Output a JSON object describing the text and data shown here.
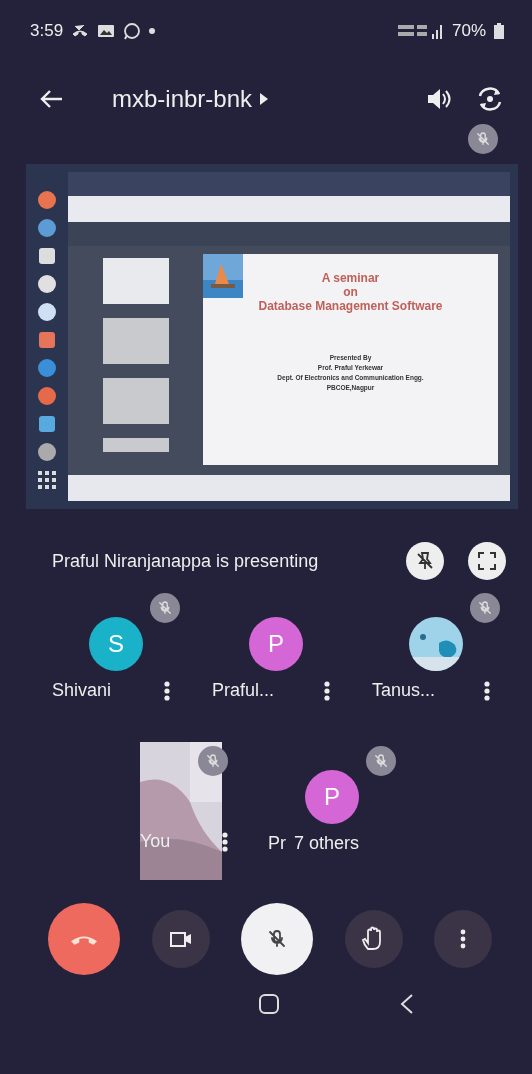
{
  "status_bar": {
    "time": "3:59",
    "battery": "70%"
  },
  "header": {
    "title": "mxb-inbr-bnk"
  },
  "presentation": {
    "slide_title": [
      "A seminar",
      "on",
      "Database Management Software"
    ],
    "slide_credits": [
      "Presented By",
      "Prof. Praful Yerkewar",
      "Dept. Of Electronics and Communication Engg.",
      "PBCOE,Nagpur"
    ],
    "presenter": "Praful Niranjanappa is presenting"
  },
  "participants": [
    {
      "name": "Shivani",
      "kind": "letter",
      "avatar": "S",
      "color": "#1ab2c9",
      "muted": true
    },
    {
      "name": "Praful...",
      "kind": "letter",
      "avatar": "P",
      "color": "#d466d6",
      "muted": false
    },
    {
      "name": "Tanus...",
      "kind": "picture",
      "muted": true
    },
    {
      "name": "You",
      "kind": "video",
      "muted": true
    },
    {
      "name": "7 others",
      "prefix": "Pr",
      "kind": "letter",
      "avatar": "P",
      "color": "#d466d6",
      "muted": true
    }
  ],
  "controls": [
    {
      "kind": "hangup"
    },
    {
      "kind": "camera"
    },
    {
      "kind": "mic",
      "muted": true
    },
    {
      "kind": "hand"
    },
    {
      "kind": "more"
    }
  ]
}
